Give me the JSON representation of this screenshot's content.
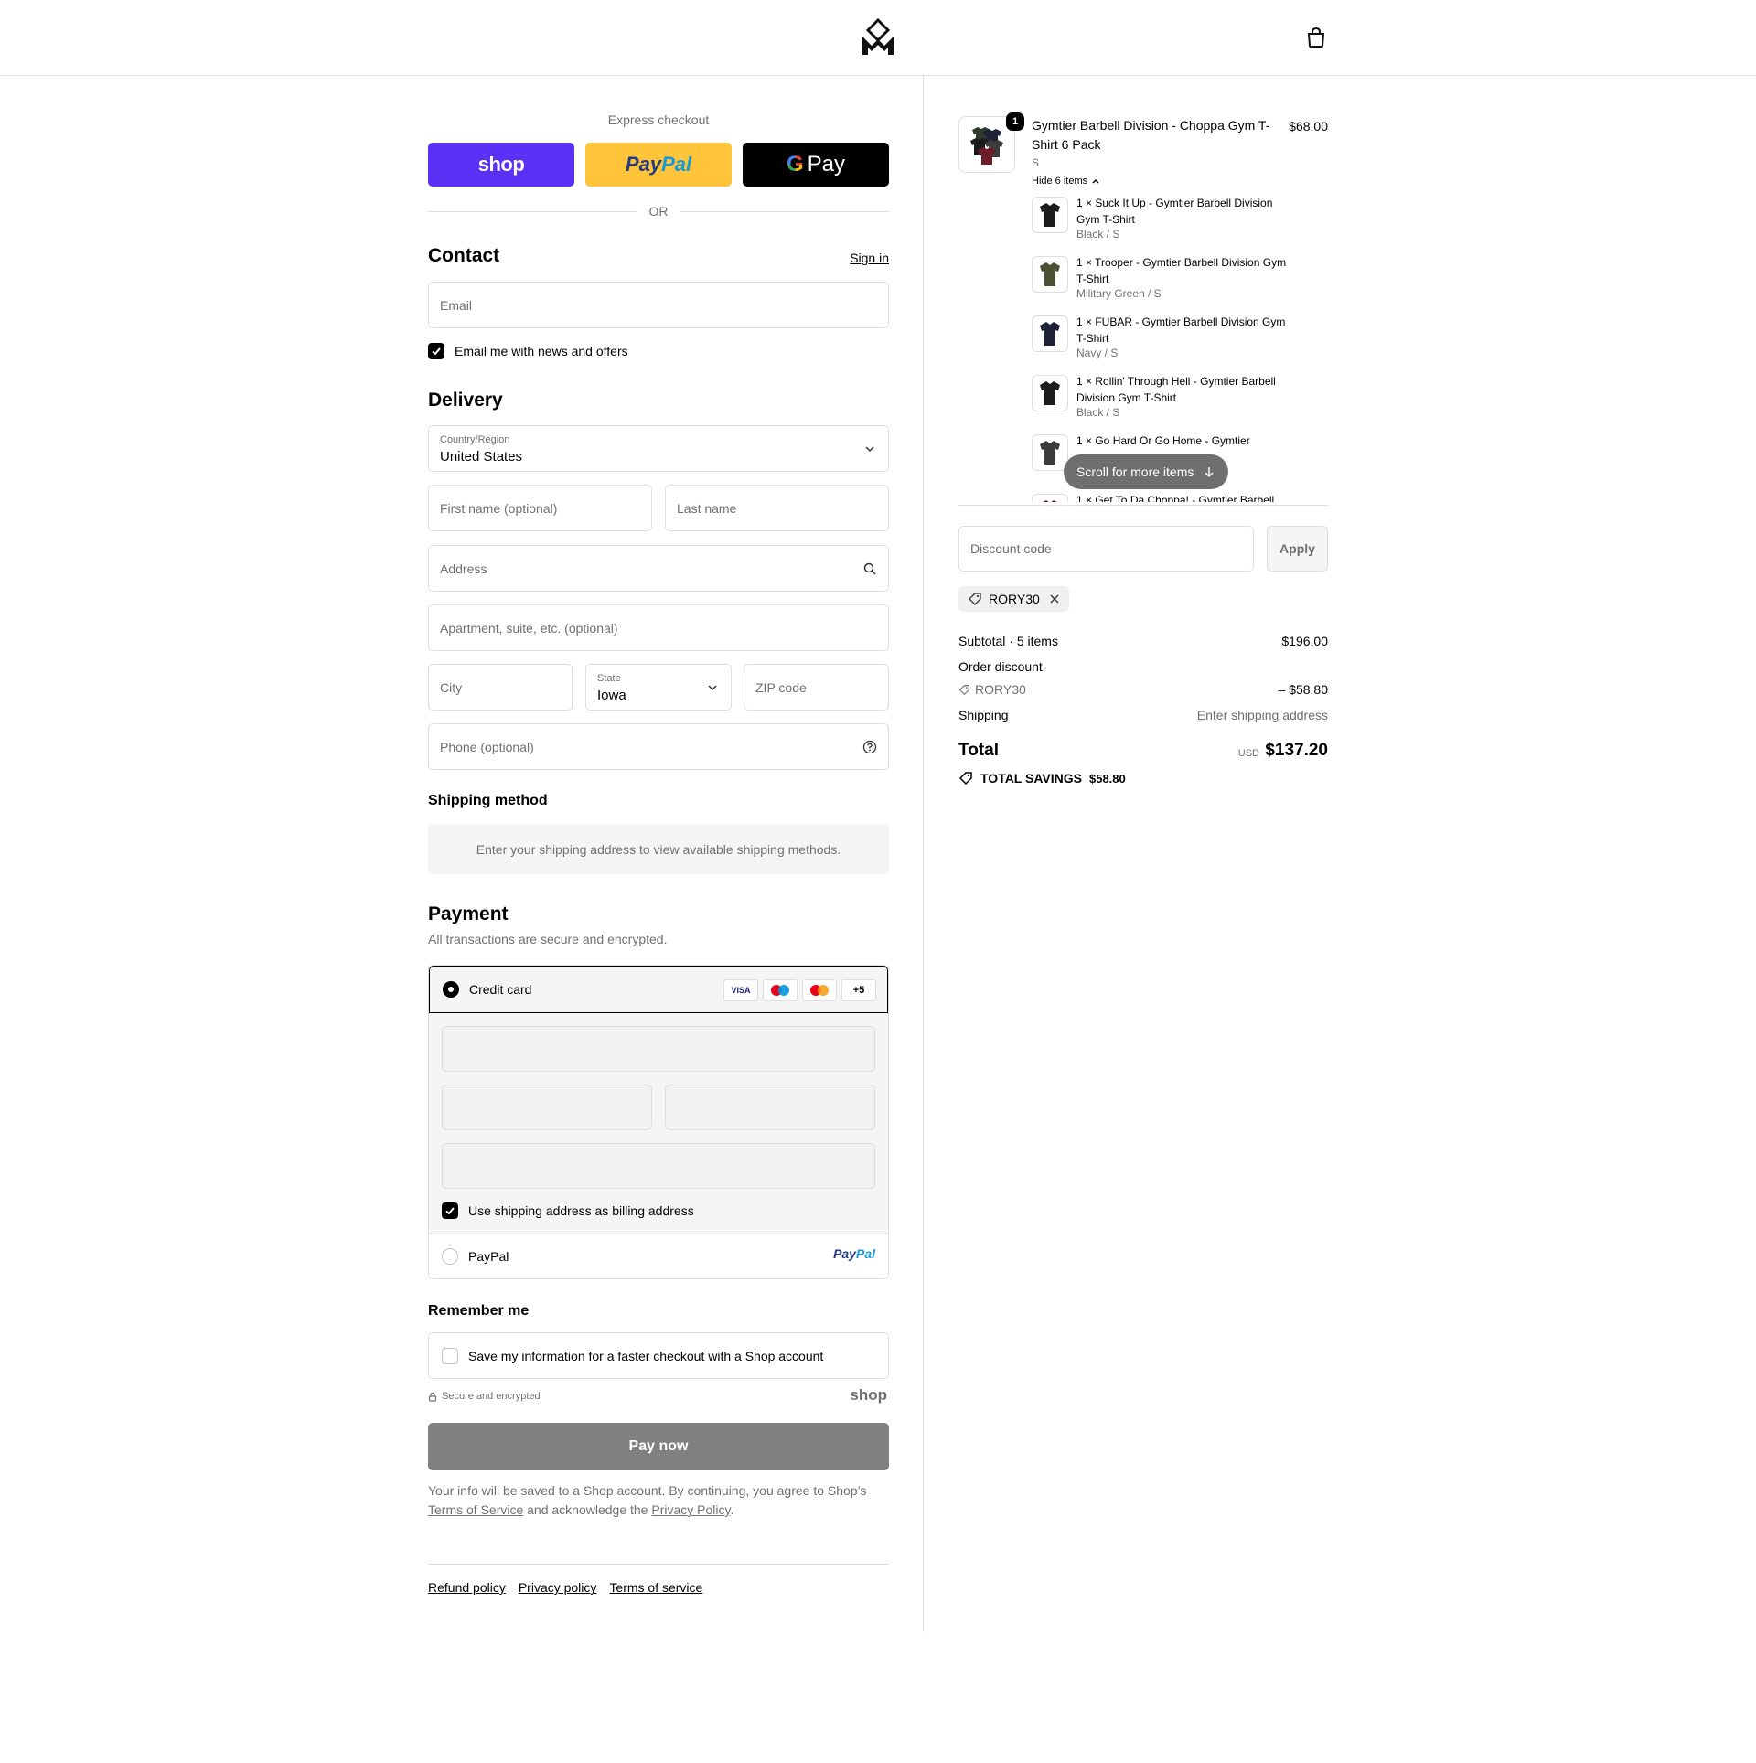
{
  "express": {
    "title": "Express checkout",
    "shop_label": "shop",
    "paypal_label_1": "Pay",
    "paypal_label_2": "Pal",
    "gpay_label": "Pay",
    "or_label": "OR"
  },
  "contact": {
    "heading": "Contact",
    "sign_in": "Sign in",
    "email_placeholder": "Email",
    "news_label": "Email me with news and offers",
    "news_checked": true
  },
  "delivery": {
    "heading": "Delivery",
    "country_label": "Country/Region",
    "country_value": "United States",
    "first_name_placeholder": "First name (optional)",
    "last_name_placeholder": "Last name",
    "address_placeholder": "Address",
    "apartment_placeholder": "Apartment, suite, etc. (optional)",
    "city_placeholder": "City",
    "state_label": "State",
    "state_value": "Iowa",
    "zip_placeholder": "ZIP code",
    "phone_placeholder": "Phone (optional)"
  },
  "shipping_method": {
    "heading": "Shipping method",
    "message": "Enter your shipping address to view available shipping methods."
  },
  "payment": {
    "heading": "Payment",
    "subtitle": "All transactions are secure and encrypted.",
    "credit_card_label": "Credit card",
    "brands": [
      "VISA",
      "Maestro",
      "Mastercard",
      "+5"
    ],
    "billing_label": "Use shipping address as billing address",
    "paypal_label": "PayPal",
    "paypal_logo_1": "Pay",
    "paypal_logo_2": "Pal"
  },
  "remember": {
    "heading": "Remember me",
    "label": "Save my information for a faster checkout with a Shop account",
    "secure_label": "Secure and encrypted",
    "shop_logo": "shop"
  },
  "pay_now": "Pay now",
  "legal": {
    "text_1": "Your info will be saved to a Shop account. By continuing, you agree to Shop’s",
    "terms_link": "Terms of Service",
    "text_2": "and acknowledge the",
    "privacy_link": "Privacy Policy",
    "text_3": "."
  },
  "footer": {
    "links": [
      "Refund policy",
      "Privacy policy",
      "Terms of service"
    ]
  },
  "order": {
    "quantity": "1",
    "product_name": "Gymtier Barbell Division - Choppa Gym T-Shirt 6 Pack",
    "product_price": "$68.00",
    "product_variant": "S",
    "hide_items": "Hide 6 items",
    "bundle_items": [
      {
        "title": "1 × Suck It Up - Gymtier Barbell Division Gym T-Shirt",
        "variant": "Black / S",
        "color": "#1c1c1c"
      },
      {
        "title": "1 × Trooper - Gymtier Barbell Division Gym T-Shirt",
        "variant": "Military Green / S",
        "color": "#4a5233"
      },
      {
        "title": "1 × FUBAR - Gymtier Barbell Division Gym T-Shirt",
        "variant": "Navy / S",
        "color": "#1d2238"
      },
      {
        "title": "1 × Rollin' Through Hell - Gymtier Barbell Division Gym T-Shirt",
        "variant": "Black / S",
        "color": "#1c1c1c"
      },
      {
        "title": "1 × Go Hard Or Go Home - Gymtier",
        "variant": "",
        "color": "#3c3c3c"
      },
      {
        "title": "1 × Get To Da Choppa! - Gymtier Barbell",
        "variant": "",
        "color": "#6b1e2a"
      }
    ],
    "scroll_more": "Scroll for more items",
    "discount_placeholder": "Discount code",
    "apply_label": "Apply",
    "applied_code": "RORY30",
    "subtotal_label": "Subtotal · 5 items",
    "subtotal_value": "$196.00",
    "order_discount_label": "Order discount",
    "discount_code": "RORY30",
    "discount_value": "– $58.80",
    "shipping_label": "Shipping",
    "shipping_value": "Enter shipping address",
    "total_label": "Total",
    "currency": "USD",
    "total_value": "$137.20",
    "savings_label": "TOTAL SAVINGS",
    "savings_value": "$58.80"
  }
}
